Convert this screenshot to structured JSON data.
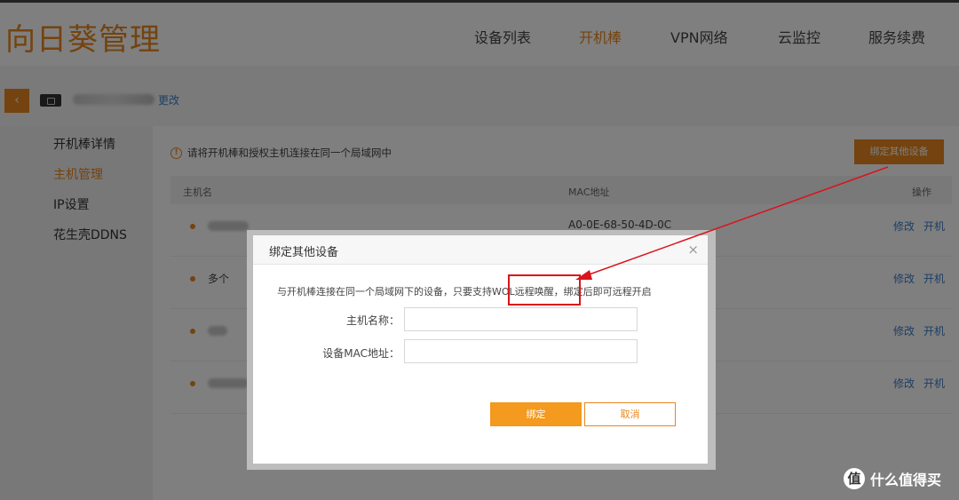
{
  "app": {
    "logo": "向日葵管理"
  },
  "nav": [
    "设备列表",
    "开机棒",
    "VPN网络",
    "云监控",
    "服务续费"
  ],
  "subbar": {
    "back_icon": "‹",
    "rename": "更改"
  },
  "sidebar": [
    "开机棒详情",
    "主机管理",
    "IP设置",
    "花生壳DDNS"
  ],
  "main": {
    "notice": "请将开机棒和授权主机连接在同一个局域网中",
    "warn_icon": "!",
    "bind_button": "绑定其他设备",
    "columns": {
      "host": "主机名",
      "mac": "MAC地址",
      "action": "操作"
    },
    "rows": [
      {
        "name": "",
        "mac": "A0-0E-68-50-4D-0C",
        "edit": "修改",
        "boot": "开机"
      },
      {
        "name": "多个",
        "mac": "",
        "edit": "修改",
        "boot": "开机"
      },
      {
        "name": "",
        "mac": "",
        "edit": "修改",
        "boot": "开机"
      },
      {
        "name": "",
        "mac": "",
        "edit": "修改",
        "boot": "开机"
      }
    ]
  },
  "modal": {
    "title": "绑定其他设备",
    "close": "×",
    "desc": "与开机棒连接在同一个局域网下的设备，只要支持WOL远程唤醒，绑定后即可远程开启",
    "host_label": "主机名称：",
    "mac_label": "设备MAC地址：",
    "host_value": "",
    "mac_value": "",
    "bind": "绑定",
    "cancel": "取消"
  },
  "watermark": {
    "icon": "值",
    "text": "什么值得买"
  },
  "colors": {
    "accent": "#e8871e",
    "link": "#3b7cc9",
    "highlight": "#d9141c"
  }
}
